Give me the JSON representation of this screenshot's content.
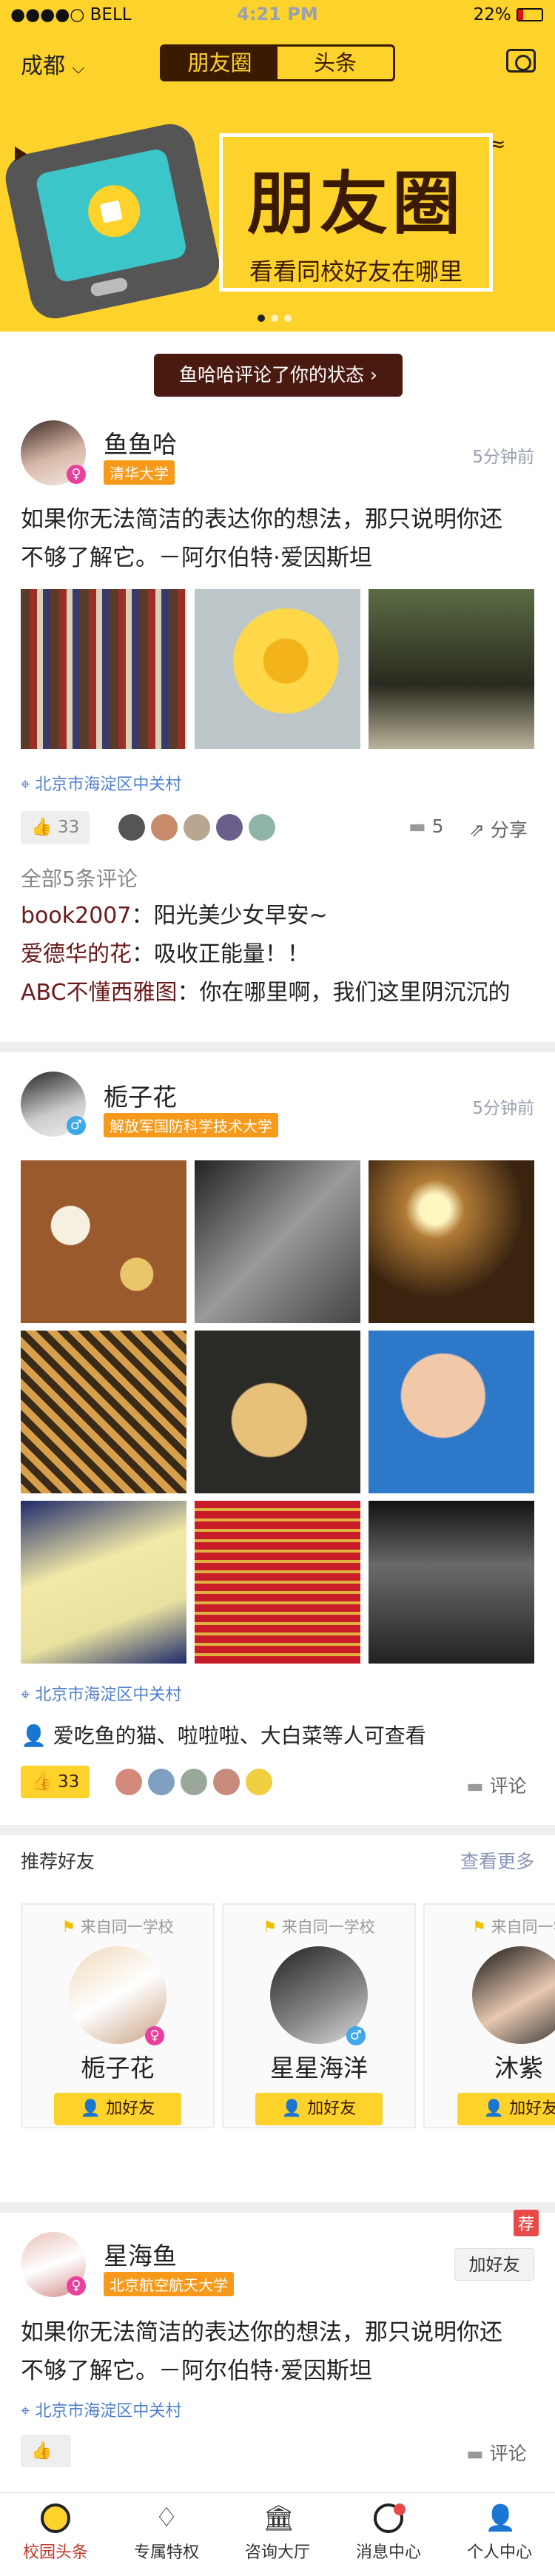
{
  "status_bar": {
    "carrier": "●●●●○ BELL",
    "time": "4:21 PM",
    "battery": "22%"
  },
  "header": {
    "city": "成都",
    "tabs": [
      "朋友圈",
      "头条"
    ]
  },
  "banner": {
    "title": "朋友圈",
    "subtitle": "看看同校好友在哪里"
  },
  "notification": "鱼哈哈评论了你的状态",
  "post1": {
    "name": "鱼鱼哈",
    "school": "清华大学",
    "time": "5分钟前",
    "text_line1": "如果你无法简洁的表达你的想法，那只说明你还",
    "text_line2": "不够了解它。－阿尔伯特·爱因斯坦",
    "location": "北京市海淀区中关村",
    "likes": "33",
    "comments_count": "5",
    "share": "分享",
    "comments_header": "全部5条评论",
    "comments": [
      {
        "user": "book2007",
        "text": "：阳光美少女早安~"
      },
      {
        "user": "爱德华的花",
        "text": "：吸收正能量！！"
      },
      {
        "user": "ABC不懂西雅图",
        "text": "：你在哪里啊，我们这里阴沉沉的"
      }
    ]
  },
  "post2": {
    "name": "栀子花",
    "school": "解放军国防科学技术大学",
    "time": "5分钟前",
    "location": "北京市海淀区中关村",
    "visibility": "爱吃鱼的猫、啦啦啦、大白菜等人可查看",
    "likes": "33",
    "comment": "评论"
  },
  "recommend": {
    "title": "推荐好友",
    "more": "查看更多",
    "cards": [
      {
        "from": "来自同一学校",
        "name": "栀子花",
        "add": "加好友"
      },
      {
        "from": "来自同一学校",
        "name": "星星海洋",
        "add": "加好友"
      },
      {
        "from": "来自同一学校",
        "name": "沐紫",
        "add": "加好友"
      }
    ]
  },
  "post3": {
    "name": "星海鱼",
    "school": "北京航空航天大学",
    "badge": "荐",
    "add": "加好友",
    "text_line1": "如果你无法简洁的表达你的想法，那只说明你还",
    "text_line2": "不够了解它。－阿尔伯特·爱因斯坦",
    "location": "北京市海淀区中关村",
    "comment": "评论"
  },
  "tabbar": [
    "校园头条",
    "专属特权",
    "咨询大厅",
    "消息中心",
    "个人中心"
  ],
  "colors": {
    "accent": "#fdd22a",
    "dark_brown": "#3a1a00",
    "school_tag": "#f79a1b",
    "male": "#3fa8e8",
    "female": "#ea3f9c"
  }
}
